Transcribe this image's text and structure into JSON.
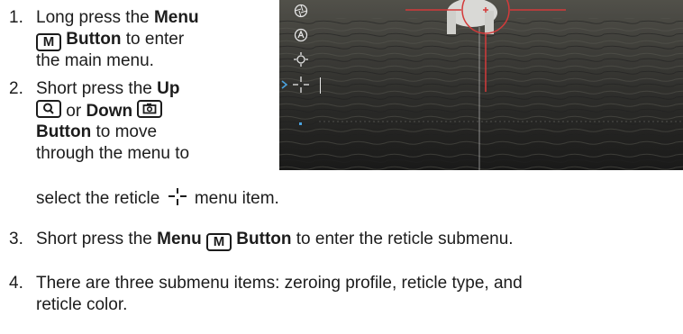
{
  "steps": [
    {
      "num": "1.",
      "line1_a": "Long press the ",
      "line1_b": "Menu",
      "key_m": "M",
      "line2_b": " Button",
      "line2_c": " to enter",
      "line3": "the main menu."
    },
    {
      "num": "2.",
      "line1_a": "Short press the ",
      "line1_b": "Up",
      "line2_a": " or ",
      "line2_b": "Down",
      "line3_b": "Button",
      "line3_c": " to move",
      "line4": "through the menu to",
      "line5_a": "select the reticle ",
      "line5_b": " menu item."
    },
    {
      "num": "3.",
      "a": "Short press the ",
      "b": "Menu",
      "key_m": "M",
      "c": " Button",
      "d": " to enter the reticle submenu."
    },
    {
      "num": "4.",
      "line1": "There are three submenu items: zeroing profile, reticle type, and",
      "line2": "reticle color."
    }
  ],
  "icons": {
    "menu_key": "m-key-icon",
    "up_key": "magnifier-key-icon",
    "down_key": "camera-key-icon",
    "reticle_inline": "reticle-icon",
    "sidebar": [
      "aperture-icon",
      "auto-mode-icon",
      "brightness-icon",
      "reticle-icon",
      "dot-indicator-icon"
    ]
  },
  "colors": {
    "text": "#1c1c1c",
    "reticle": "#d43a3a",
    "menu_icon": "#e6e6e6",
    "selection": "#4aa3e0"
  }
}
